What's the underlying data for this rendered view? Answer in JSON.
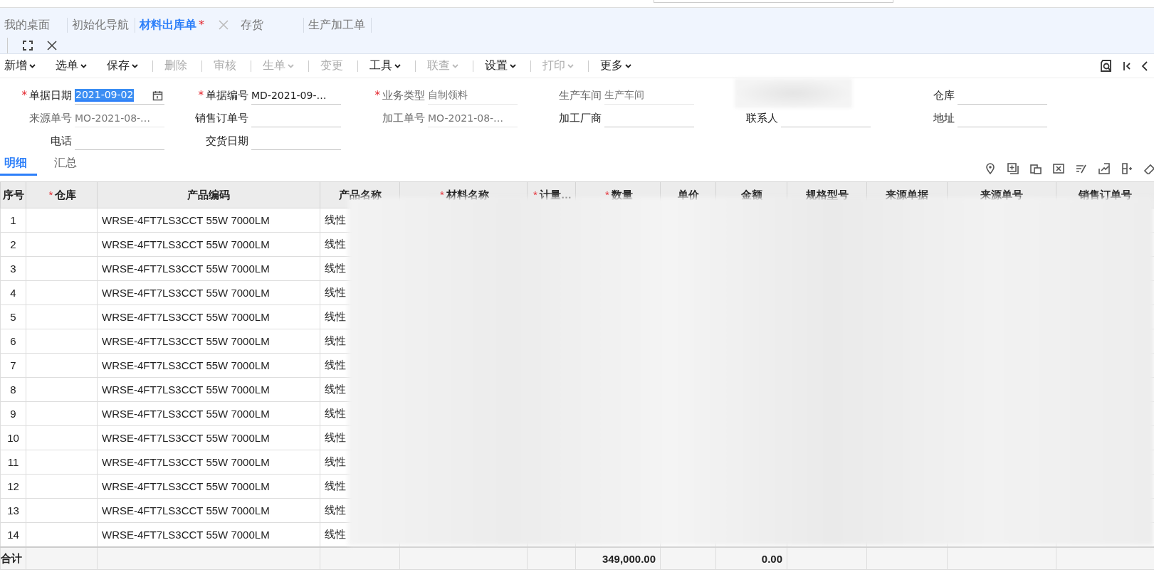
{
  "tabs": [
    {
      "label": "我的桌面",
      "selected": false
    },
    {
      "label": "初始化导航",
      "selected": false
    },
    {
      "label": "材料出库单",
      "selected": true,
      "marker": "*",
      "closable": true
    },
    {
      "label": "存货",
      "selected": false
    },
    {
      "label": "生产加工单",
      "selected": false
    }
  ],
  "toolbar": [
    {
      "label": "新增",
      "dropdown": true,
      "disabled": false
    },
    {
      "label": "选单",
      "dropdown": true,
      "disabled": false
    },
    {
      "label": "保存",
      "dropdown": true,
      "disabled": false
    },
    {
      "label": "删除",
      "dropdown": false,
      "disabled": true
    },
    {
      "label": "审核",
      "dropdown": false,
      "disabled": true
    },
    {
      "label": "生单",
      "dropdown": true,
      "disabled": true
    },
    {
      "label": "变更",
      "dropdown": false,
      "disabled": true
    },
    {
      "label": "工具",
      "dropdown": true,
      "disabled": false
    },
    {
      "label": "联查",
      "dropdown": true,
      "disabled": true
    },
    {
      "label": "设置",
      "dropdown": true,
      "disabled": false
    },
    {
      "label": "打印",
      "dropdown": true,
      "disabled": true
    },
    {
      "label": "更多",
      "dropdown": true,
      "disabled": false
    }
  ],
  "form": [
    {
      "kind": "date",
      "label": "单据日期",
      "mark": "*",
      "value": "2021-09-02",
      "disabled": false
    },
    {
      "kind": "text",
      "label": "单据编号",
      "mark": "*",
      "value": "MD-2021-09-…",
      "disabled": false
    },
    {
      "kind": "text",
      "label": "业务类型",
      "mark": "*",
      "value": "自制领料",
      "disabled": true
    },
    {
      "kind": "text",
      "label": "生产车间",
      "value": "生产车间",
      "disabled": true
    },
    {
      "kind": "blurred"
    },
    {
      "kind": "text",
      "label": "仓库",
      "disabled": false
    },
    {
      "kind": "text",
      "label": "来源单号",
      "value": "MO-2021-08-…",
      "disabled": true
    },
    {
      "kind": "text",
      "label": "销售订单号",
      "disabled": false
    },
    {
      "kind": "text",
      "label": "加工单号",
      "value": "MO-2021-08-…",
      "disabled": true
    },
    {
      "kind": "text",
      "label": "加工厂商",
      "disabled": false
    },
    {
      "kind": "text",
      "label": "联系人",
      "disabled": false
    },
    {
      "kind": "text",
      "label": "地址",
      "disabled": false
    },
    {
      "kind": "text",
      "label": "电话",
      "disabled": false
    },
    {
      "kind": "text",
      "label": "交货日期",
      "disabled": false
    }
  ],
  "sub_tabs": [
    {
      "label": "明细",
      "selected": true
    },
    {
      "label": "汇总",
      "selected": false
    }
  ],
  "table": {
    "columns": [
      {
        "label": "序号"
      },
      {
        "label": "仓库",
        "mark": "*"
      },
      {
        "label": "产品编码"
      },
      {
        "label": "产品名称"
      },
      {
        "label": "材料名称",
        "mark": "*"
      },
      {
        "label": "计量…",
        "mark": "*"
      },
      {
        "label": "数量",
        "mark": "*"
      },
      {
        "label": "单价"
      },
      {
        "label": "金额"
      },
      {
        "label": "规格型号"
      },
      {
        "label": "来源单据"
      },
      {
        "label": "来源单号"
      },
      {
        "label": "销售订单号"
      }
    ],
    "rows": [
      {
        "no": "1",
        "code": "WRSE-4FT7LS3CCT 55W 7000LM",
        "name": "线性"
      },
      {
        "no": "2",
        "code": "WRSE-4FT7LS3CCT 55W 7000LM",
        "name": "线性"
      },
      {
        "no": "3",
        "code": "WRSE-4FT7LS3CCT 55W 7000LM",
        "name": "线性"
      },
      {
        "no": "4",
        "code": "WRSE-4FT7LS3CCT 55W 7000LM",
        "name": "线性"
      },
      {
        "no": "5",
        "code": "WRSE-4FT7LS3CCT 55W 7000LM",
        "name": "线性"
      },
      {
        "no": "6",
        "code": "WRSE-4FT7LS3CCT 55W 7000LM",
        "name": "线性"
      },
      {
        "no": "7",
        "code": "WRSE-4FT7LS3CCT 55W 7000LM",
        "name": "线性"
      },
      {
        "no": "8",
        "code": "WRSE-4FT7LS3CCT 55W 7000LM",
        "name": "线性"
      },
      {
        "no": "9",
        "code": "WRSE-4FT7LS3CCT 55W 7000LM",
        "name": "线性"
      },
      {
        "no": "10",
        "code": "WRSE-4FT7LS3CCT 55W 7000LM",
        "name": "线性"
      },
      {
        "no": "11",
        "code": "WRSE-4FT7LS3CCT 55W 7000LM",
        "name": "线性"
      },
      {
        "no": "12",
        "code": "WRSE-4FT7LS3CCT 55W 7000LM",
        "name": "线性"
      },
      {
        "no": "13",
        "code": "WRSE-4FT7LS3CCT 55W 7000LM",
        "name": "线性"
      },
      {
        "no": "14",
        "code": "WRSE-4FT7LS3CCT 55W 7000LM",
        "name": "线性"
      }
    ],
    "total": {
      "label": "合计",
      "quantity": "349,000.00",
      "amount": "0.00"
    }
  }
}
